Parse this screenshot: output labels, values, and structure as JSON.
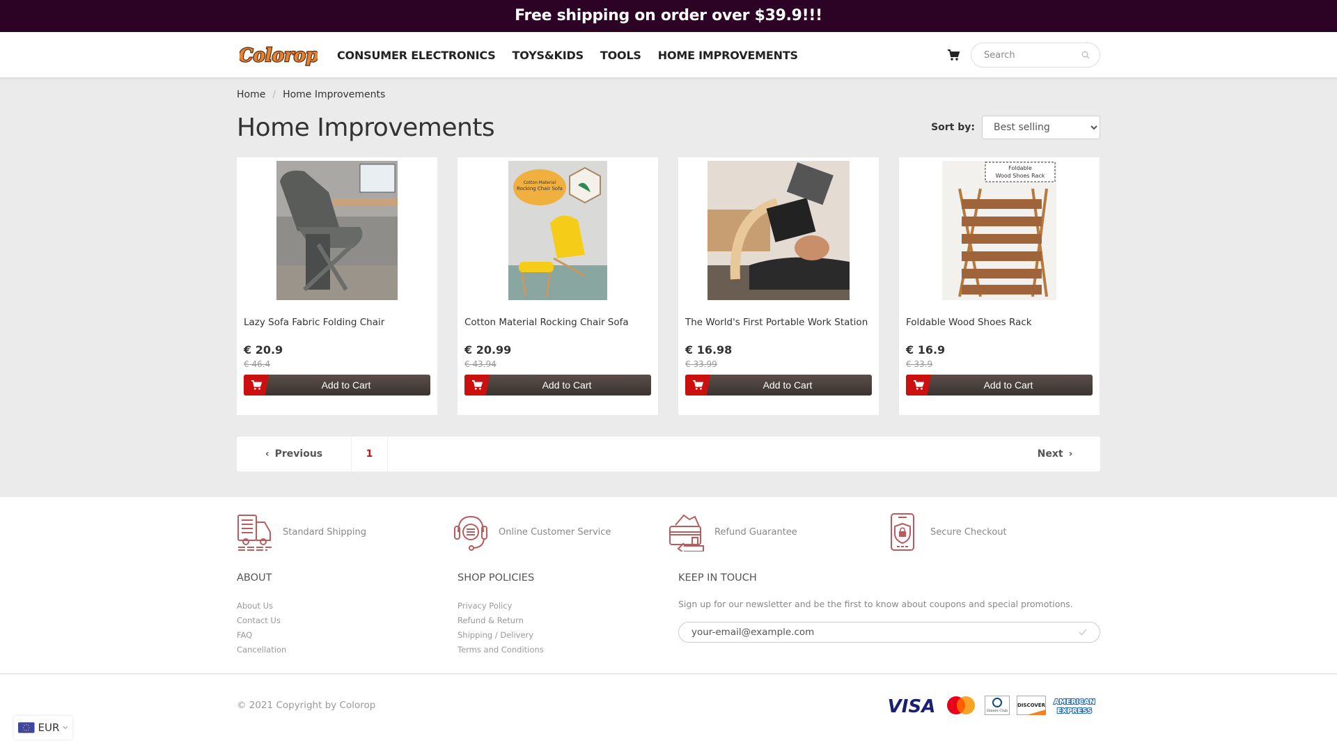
{
  "announcement": "Free shipping on order over $39.9!!!",
  "header": {
    "logo_text": "Colorop",
    "nav": [
      "CONSUMER ELECTRONICS",
      "TOYS&KIDS",
      "TOOLS",
      "HOME IMPROVEMENTS"
    ],
    "search_placeholder": "Search"
  },
  "breadcrumb": {
    "home": "Home",
    "separator": "/",
    "current": "Home Improvements"
  },
  "page_title": "Home Improvements",
  "sort": {
    "label": "Sort by:",
    "selected": "Best selling"
  },
  "products": [
    {
      "name": "Lazy Sofa Fabric Folding Chair",
      "price": "€ 20.9",
      "old_price": "€ 46.4",
      "button": "Add to Cart"
    },
    {
      "name": "Cotton Material Rocking Chair Sofa",
      "price": "€ 20.99",
      "old_price": "€ 43.94",
      "button": "Add to Cart"
    },
    {
      "name": "The World's First Portable Work Station",
      "price": "€ 16.98",
      "old_price": "€ 33.99",
      "button": "Add to Cart"
    },
    {
      "name": "Foldable Wood Shoes Rack",
      "price": "€ 16.9",
      "old_price": "€ 33.9",
      "button": "Add to Cart"
    }
  ],
  "product_image_captions": {
    "rocking_chair": [
      "Cotton Material",
      "Rocking Chair Sofa"
    ],
    "shoes_rack": [
      "Foldable",
      "Wood Shoes Rack"
    ]
  },
  "pagination": {
    "previous": "Previous",
    "current_page": "1",
    "next": "Next"
  },
  "features": [
    "Standard Shipping",
    "Online Customer Service",
    "Refund Guarantee",
    "Secure Checkout"
  ],
  "footer": {
    "about": {
      "title": "ABOUT",
      "links": [
        "About Us",
        "Contact Us",
        "FAQ",
        "Cancellation"
      ]
    },
    "policies": {
      "title": "SHOP POLICIES",
      "links": [
        "Privacy Policy",
        "Refund & Return",
        "Shipping / Delivery",
        "Terms and Conditions"
      ]
    },
    "newsletter": {
      "title": "KEEP IN TOUCH",
      "text": "Sign up for our newsletter and be the first to know about coupons and special promotions.",
      "placeholder": "your-email@example.com"
    },
    "copyright": "© 2021 Copyright by Colorop",
    "payments": [
      "VISA",
      "Mastercard",
      "Diners Club",
      "DISCOVER",
      "AMERICAN EXPRESS"
    ]
  },
  "currency": {
    "code": "EUR"
  },
  "colors": {
    "announcement_bg": "#2d0325",
    "accent_red": "#cc1010",
    "feature_icon": "#b85c5c",
    "cart_button": "#4a403c"
  }
}
